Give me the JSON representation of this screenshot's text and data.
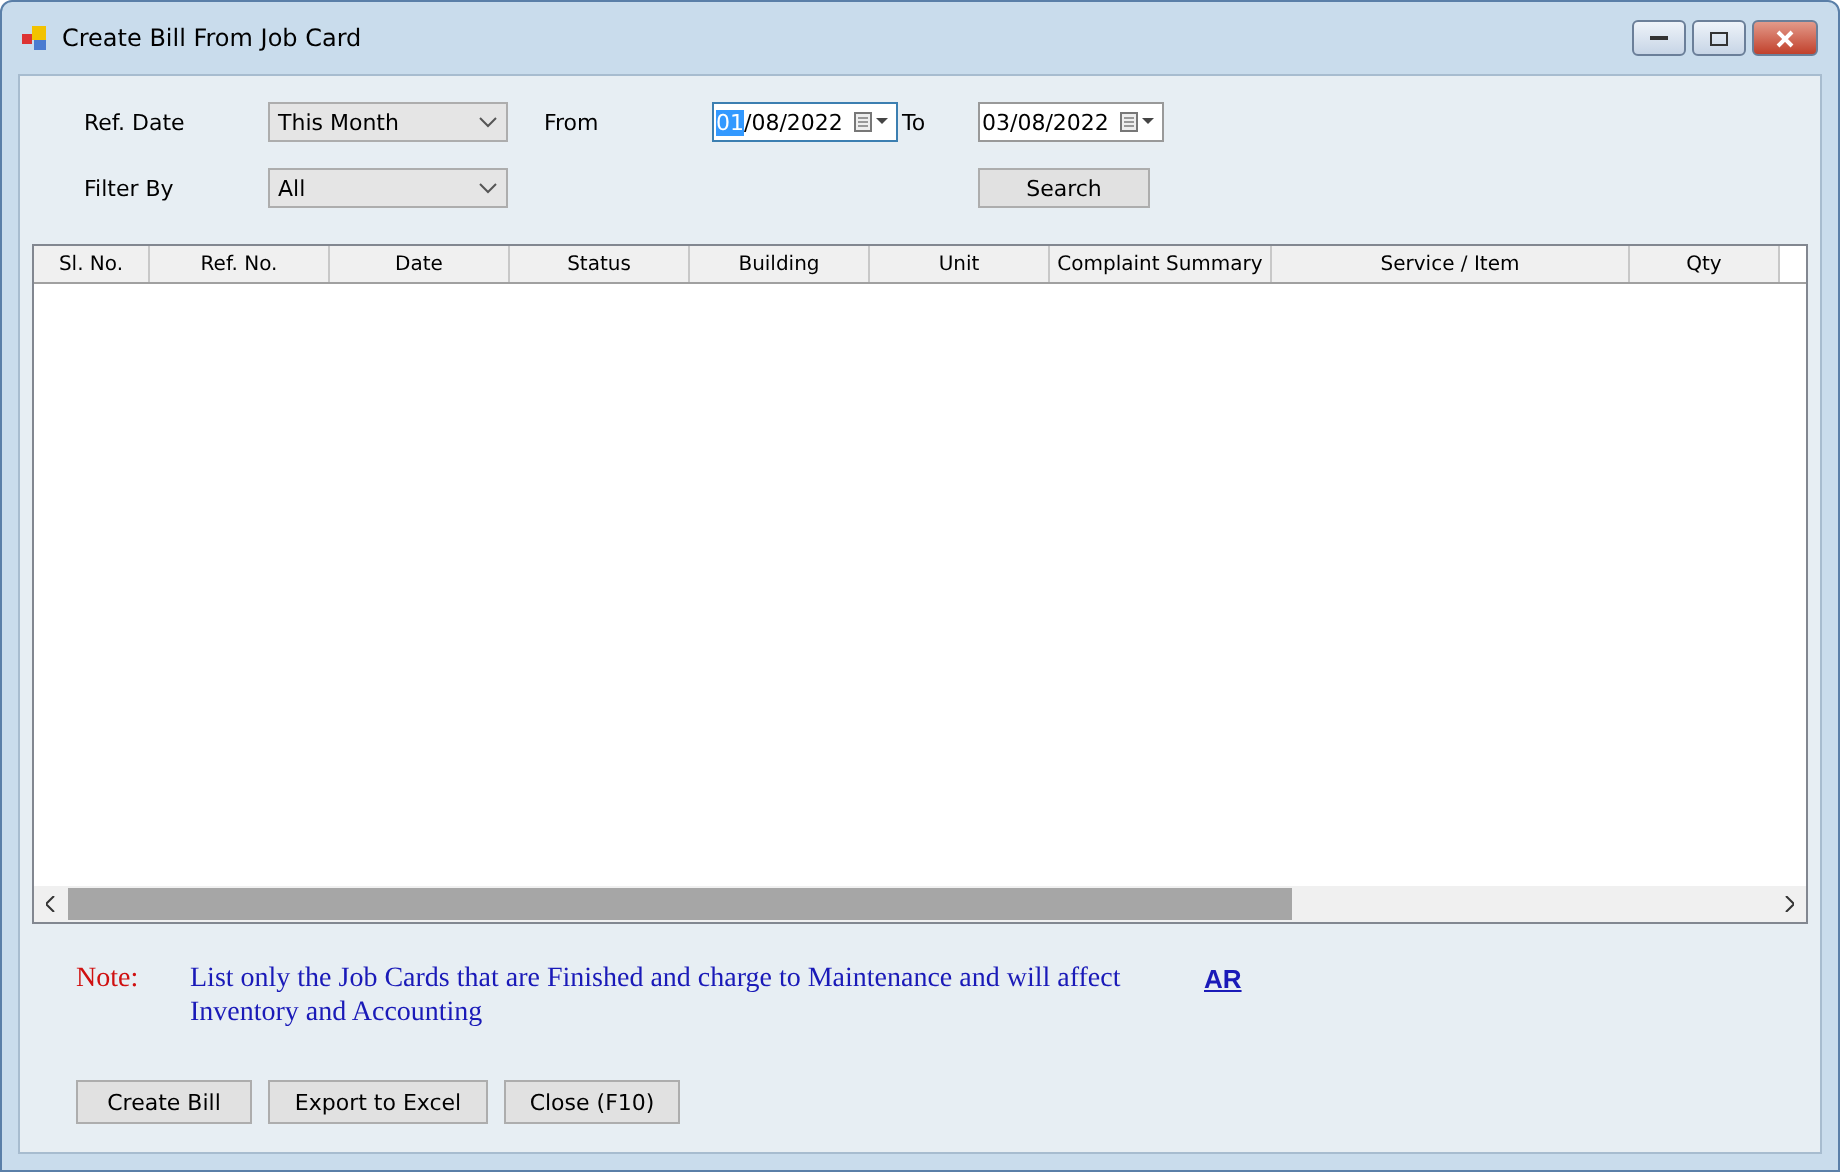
{
  "window": {
    "title": "Create Bill From Job Card"
  },
  "filters": {
    "ref_date": {
      "label": "Ref. Date",
      "value": "This Month"
    },
    "filter_by": {
      "label": "Filter By",
      "value": "All"
    },
    "from": {
      "label": "From",
      "value": "01/08/2022",
      "focused": true
    },
    "to": {
      "label": "To",
      "value": "03/08/2022",
      "focused": false
    },
    "search_button": "Search"
  },
  "table": {
    "columns": [
      "Sl. No.",
      "Ref. No.",
      "Date",
      "Status",
      "Building",
      "Unit",
      "Complaint Summary",
      "Service / Item",
      "Qty"
    ]
  },
  "note": {
    "label": "Note:",
    "text": "List only the Job Cards that are Finished and charge to Maintenance and will affect Inventory and Accounting",
    "link": "AR"
  },
  "buttons": [
    "Create Bill",
    "Export to Excel",
    "Close (F10)"
  ]
}
